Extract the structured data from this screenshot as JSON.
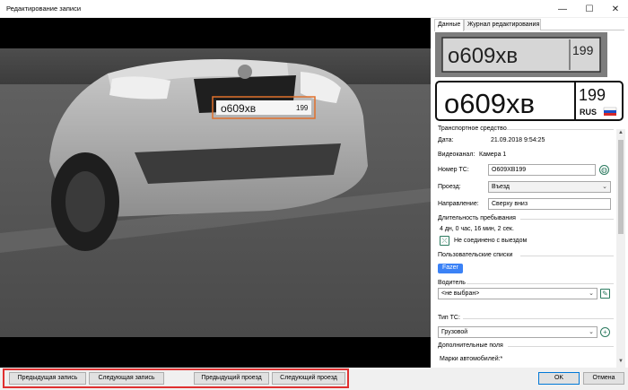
{
  "window": {
    "title": "Редактирование записи",
    "minimize": "—",
    "maximize": "☐",
    "close": "✕"
  },
  "photo": {
    "plate_text": "о609хв",
    "plate_region": "199"
  },
  "tabs": [
    {
      "label": "Данные",
      "active": true
    },
    {
      "label": "Журнал редактирования",
      "active": false
    }
  ],
  "plate": {
    "crop_text": "о609хв",
    "crop_region": "199",
    "number": "о609хв",
    "region": "199",
    "country": "RUS"
  },
  "vehicle": {
    "section_title": "Транспортное средство",
    "date_label": "Дата:",
    "date_value": "21.09.2018 9:54:25",
    "channel_label": "Видеоканал:",
    "channel_value": "Камера 1",
    "number_label": "Номер ТС:",
    "number_value": "О609ХВ199",
    "passage_label": "Проезд:",
    "passage_value": "Въезд",
    "direction_label": "Направление:",
    "direction_value": "Сверху вниз"
  },
  "stay": {
    "section_title": "Длительность пребывания",
    "duration": "4 дн, 0 час, 16 мин, 2 сек.",
    "link_status": "Не соединено с выездом"
  },
  "user_lists": {
    "section_title": "Пользовательские списки",
    "badge": "Fazer"
  },
  "driver": {
    "section_title": "Водитель",
    "value": "<не выбран>"
  },
  "vehicle_type": {
    "section_title": "Тип ТС:",
    "value": "Грузовой"
  },
  "extra": {
    "section_title": "Дополнительные поля",
    "brands_label": "Марки автомобилей:*"
  },
  "buttons": {
    "prev_record": "Предыдущая запись",
    "next_record": "Следующая запись",
    "prev_pass": "Предыдущий проезд",
    "next_pass": "Следующий проезд",
    "ok": "OK",
    "cancel": "Отмена"
  },
  "colors": {
    "highlight": "#e03030",
    "badge": "#3b82f6",
    "accent_icon": "#2b7a5f"
  }
}
